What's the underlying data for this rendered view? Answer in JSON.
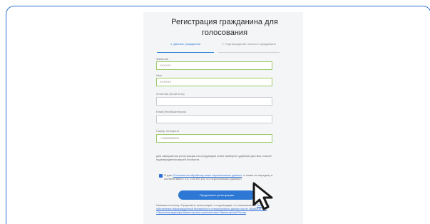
{
  "form": {
    "title": "Регистрация гражданина для голосования",
    "tabs": [
      {
        "label": "1. Данные гражданина",
        "active": true
      },
      {
        "label": "2. Подтверждение личности гражданина",
        "active": false
      }
    ],
    "fields": [
      {
        "label": "Фамилия",
        "value": "XXXXXX"
      },
      {
        "label": "Имя",
        "value": "XXXXXX"
      },
      {
        "label": "Отчество (Если есть)",
        "value": ""
      },
      {
        "label": "Email (Необязательно)",
        "value": ""
      },
      {
        "label": "Номер телефона",
        "value": "+79000000000"
      }
    ],
    "note": "Для завершения регистрации на следующем этапе выберите удобный для Вас способ подтверждения вашей личности.",
    "consent": {
      "prefix": "Я даю ",
      "link": "Согласие на обработку моих персональных данных",
      "suffix": ", а также их передачу в соответствии с ч.3, ст.6 ФЗ-152 «О персональных данных»"
    },
    "submit_label": "Продолжить регистрацию",
    "legal": {
      "prefix": "Нажимая на кнопку «Продолжить регистрацию» и подтверждая, что ознакомлены с ",
      "link": "Политикой обеспечения информационной безопасности и персональных данных при их обработке ФАУ «Проектная дирекция Министерства строительства» Министерства России",
      "suffix": ""
    }
  },
  "colors": {
    "accent": "#2d78d4",
    "frame_border": "#2f6fd6",
    "valid_border": "#9ccb6a"
  },
  "icons": {
    "cursor": "pointer-hand-icon"
  }
}
